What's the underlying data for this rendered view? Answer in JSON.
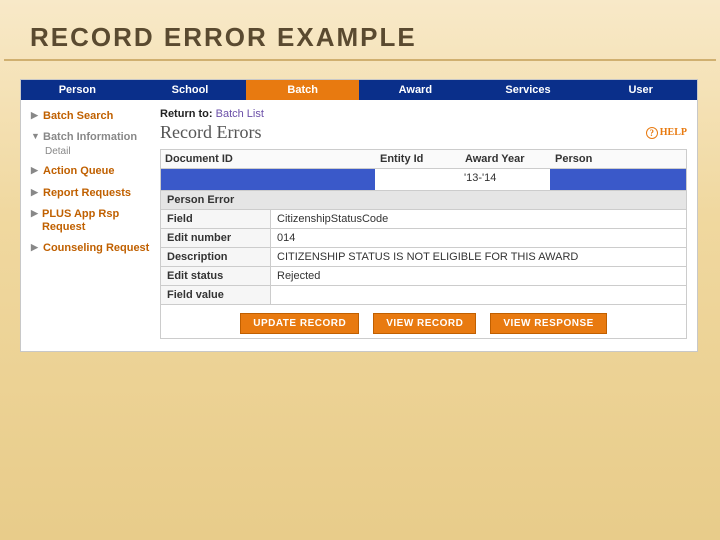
{
  "slide": {
    "title": "RECORD ERROR EXAMPLE"
  },
  "topnav": {
    "items": [
      {
        "label": "Person"
      },
      {
        "label": "School"
      },
      {
        "label": "Batch"
      },
      {
        "label": "Award"
      },
      {
        "label": "Services"
      },
      {
        "label": "User"
      }
    ],
    "active_index": 2
  },
  "sidebar": {
    "items": [
      {
        "label": "Batch Search",
        "expanded": false
      },
      {
        "label": "Batch Information",
        "expanded": true,
        "sub": "Detail"
      },
      {
        "label": "Action Queue",
        "expanded": false
      },
      {
        "label": "Report Requests",
        "expanded": false
      },
      {
        "label": "PLUS App Rsp Request",
        "expanded": false
      },
      {
        "label": "Counseling Request",
        "expanded": false
      }
    ]
  },
  "main": {
    "return_label": "Return to:",
    "return_link": "Batch List",
    "heading": "Record Errors",
    "help_label": "HELP",
    "columns": {
      "doc": "Document ID",
      "ent": "Entity Id",
      "year": "Award Year",
      "person": "Person"
    },
    "row": {
      "award_year": "'13-'14"
    },
    "section": "Person Error",
    "fields": {
      "field_label": "Field",
      "field_value": "CitizenshipStatusCode",
      "edit_num_label": "Edit number",
      "edit_num_value": "014",
      "desc_label": "Description",
      "desc_value": "CITIZENSHIP STATUS IS NOT ELIGIBLE FOR THIS AWARD",
      "edit_status_label": "Edit status",
      "edit_status_value": "Rejected",
      "field_value_label": "Field value",
      "field_value_value": ""
    },
    "buttons": {
      "update": "UPDATE RECORD",
      "view": "VIEW RECORD",
      "response": "VIEW RESPONSE"
    }
  }
}
